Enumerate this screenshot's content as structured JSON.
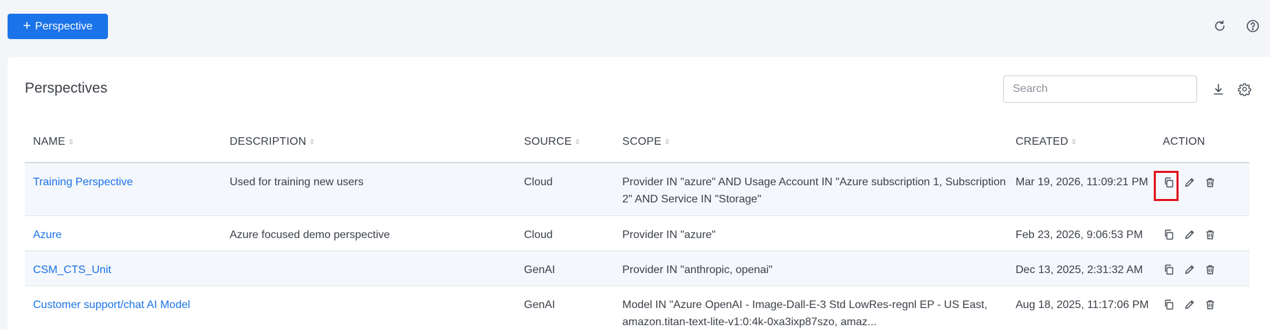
{
  "toolbar": {
    "add_label": "Perspective",
    "refresh_icon": "refresh-icon",
    "help_icon": "help-icon"
  },
  "panel": {
    "title": "Perspectives",
    "search": {
      "placeholder": "Search",
      "value": ""
    },
    "download_icon": "download-icon",
    "settings_icon": "gear-icon"
  },
  "table": {
    "headers": {
      "name": "NAME",
      "description": "DESCRIPTION",
      "source": "SOURCE",
      "scope": "SCOPE",
      "created": "CREATED",
      "action": "ACTION"
    },
    "rows": [
      {
        "name": "Training Perspective",
        "description": "Used for training new users",
        "source": "Cloud",
        "scope": "Provider IN \"azure\" AND Usage Account IN \"Azure subscription 1, Subscription 2\" AND Service IN \"Storage\"",
        "created": "Mar 19, 2026, 11:09:21 PM"
      },
      {
        "name": "Azure",
        "description": "Azure focused demo perspective",
        "source": "Cloud",
        "scope": "Provider IN \"azure\"",
        "created": "Feb 23, 2026, 9:06:53 PM"
      },
      {
        "name": "CSM_CTS_Unit",
        "description": "",
        "source": "GenAI",
        "scope": "Provider IN \"anthropic, openai\"",
        "created": "Dec 13, 2025, 2:31:32 AM"
      },
      {
        "name": "Customer support/chat AI Model",
        "description": "",
        "source": "GenAI",
        "scope": "Model IN \"Azure OpenAI - Image-Dall-E-3 Std LowRes-regnl EP - US East, amazon.titan-text-lite-v1:0:4k-0xa3ixp87szo, amaz...",
        "created": "Aug 18, 2025, 11:17:06 PM"
      }
    ],
    "row_action_icons": [
      "copy-icon",
      "edit-icon",
      "delete-icon"
    ]
  },
  "colors": {
    "accent": "#1a73e8",
    "highlight": "#e0141e",
    "page_bg": "#f3f5f9"
  }
}
